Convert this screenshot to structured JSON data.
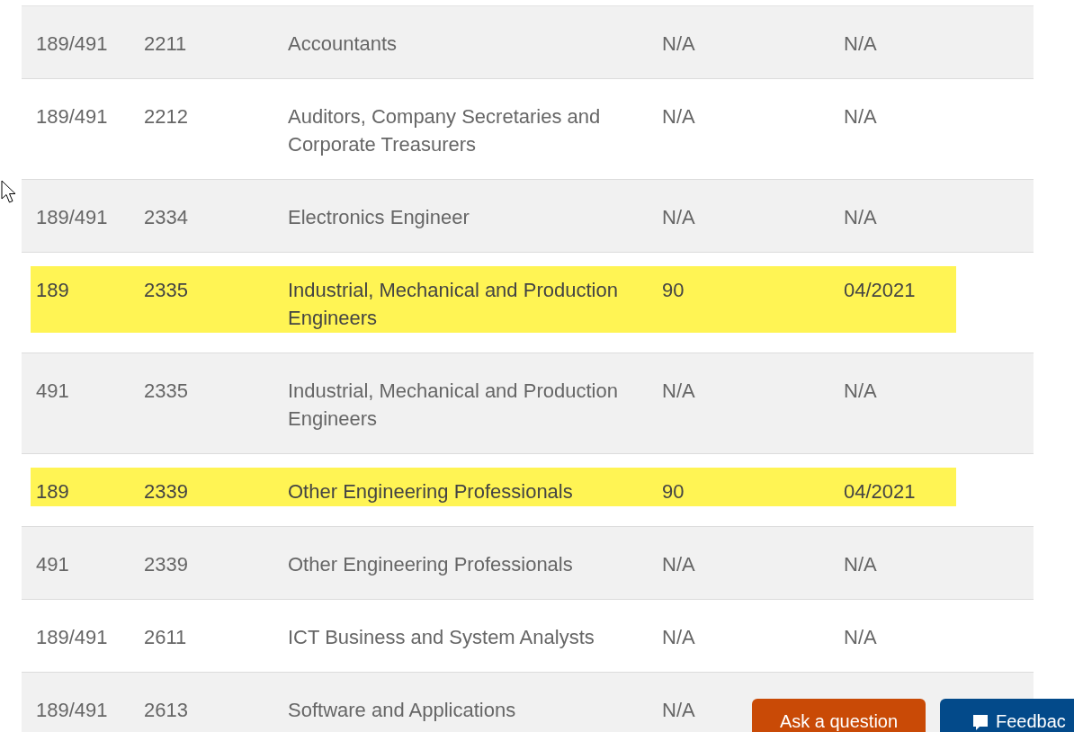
{
  "table": {
    "rows": [
      {
        "visa": "189/491",
        "code": "2211",
        "occupation": "Accountants",
        "score": "N/A",
        "date": "N/A",
        "highlighted": false
      },
      {
        "visa": "189/491",
        "code": "2212",
        "occupation": "Auditors, Company Secretaries and Corporate Treasurers",
        "score": "N/A",
        "date": "N/A",
        "highlighted": false
      },
      {
        "visa": "189/491",
        "code": "2334",
        "occupation": "Electronics Engineer",
        "score": "N/A",
        "date": "N/A",
        "highlighted": false
      },
      {
        "visa": "189",
        "code": "2335",
        "occupation": "Industrial, Mechanical and Production Engineers",
        "score": "90",
        "date": "04/2021",
        "highlighted": true
      },
      {
        "visa": "491",
        "code": "2335",
        "occupation": "Industrial, Mechanical and Production Engineers",
        "score": "N/A",
        "date": "N/A",
        "highlighted": false
      },
      {
        "visa": "189",
        "code": "2339",
        "occupation": "Other Engineering Professionals",
        "score": "90",
        "date": "04/2021",
        "highlighted": true
      },
      {
        "visa": "491",
        "code": "2339",
        "occupation": "Other Engineering Professionals",
        "score": "N/A",
        "date": "N/A",
        "highlighted": false
      },
      {
        "visa": "189/491",
        "code": "2611",
        "occupation": "ICT Business and System Analysts",
        "score": "N/A",
        "date": "N/A",
        "highlighted": false
      },
      {
        "visa": "189/491",
        "code": "2613",
        "occupation": "Software and Applications",
        "score": "N/A",
        "highlighted": false
      }
    ]
  },
  "floating_buttons": {
    "ask": "Ask a question",
    "feedback": "Feedbac"
  }
}
